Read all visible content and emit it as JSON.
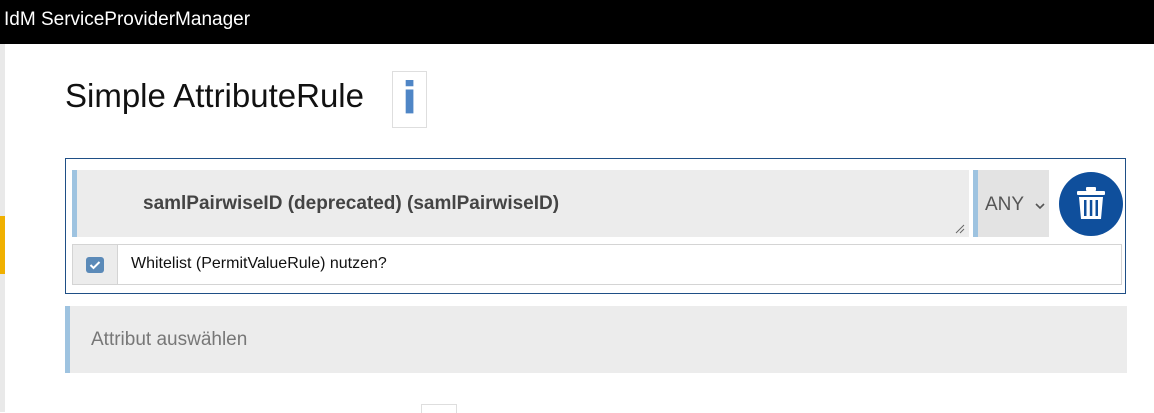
{
  "header": {
    "app_title": "IdM ServiceProviderManager"
  },
  "page": {
    "title": "Simple AttributeRule",
    "info_icon": "info-icon",
    "info_glyph": "i"
  },
  "rule": {
    "attribute_value": "samlPairwiseID (deprecated) (samlPairwiseID)",
    "match_select_value": "ANY",
    "delete_icon": "trash-icon",
    "whitelist_checked": true,
    "whitelist_label": "Whitelist (PermitValueRule) nutzen?"
  },
  "attribute_picker": {
    "placeholder": "Attribut auswählen"
  },
  "colors": {
    "header_bg": "#000000",
    "accent_blue": "#0f4f9c",
    "input_border_left": "#9ec3e0",
    "input_bg": "#ececec",
    "left_marker": "#f0b000"
  }
}
